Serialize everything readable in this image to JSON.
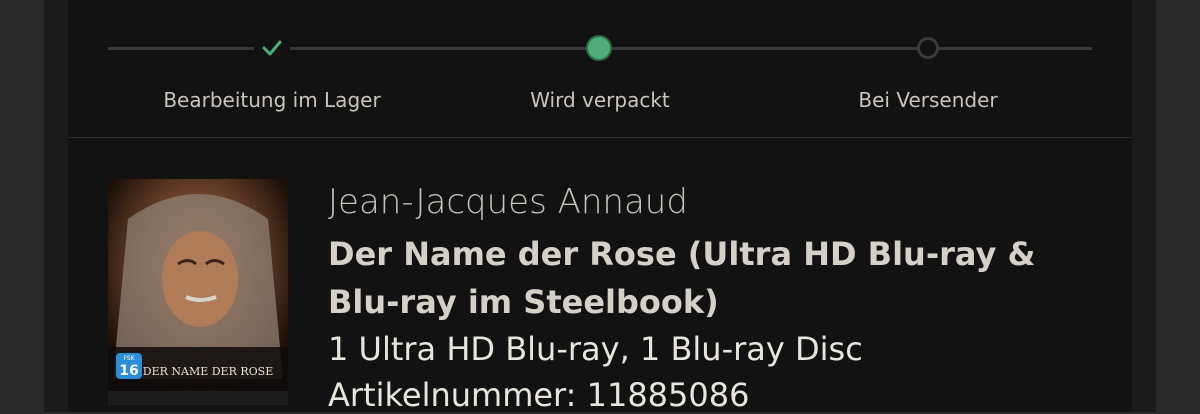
{
  "progress": {
    "steps": [
      {
        "label": "Bearbeitung im Lager",
        "state": "done"
      },
      {
        "label": "Wird verpackt",
        "state": "active"
      },
      {
        "label": "Bei Versender",
        "state": "pending"
      }
    ],
    "colors": {
      "done": "#4fae78",
      "active": "#4fae78",
      "pending": "#3c3c3c"
    }
  },
  "product": {
    "author": "Jean-Jacques Annaud",
    "title": "Der Name der Rose (Ultra HD Blu-ray & Blu-ray im Steelbook)",
    "format": "1 Ultra HD Blu-ray, 1 Blu-ray Disc",
    "article_number_line": "Artikelnummer: 11885086",
    "cover": {
      "title_text": "DER NAME DER ROSE",
      "fsk": "16",
      "fsk_label": "FSK"
    }
  }
}
